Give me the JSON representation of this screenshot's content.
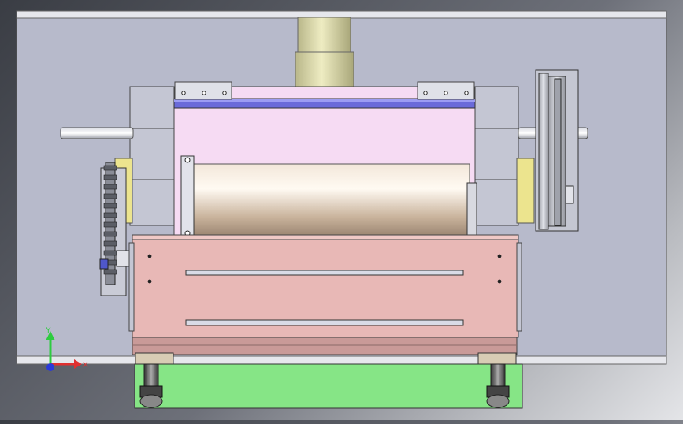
{
  "viewport": {
    "background_gradient": [
      "#3a3d44",
      "#6d7079",
      "#b9bbc0",
      "#e4e5e8"
    ]
  },
  "model": {
    "base_plate_color": "#b7bacb",
    "rail_color": "#e6e7ec",
    "pink_housing_color": "#f6dbf3",
    "roller_color_light": "#fbf3e8",
    "roller_color_dark": "#b39c85",
    "lower_box_color": "#e8b8b6",
    "foot_plate_color": "#86e586",
    "spindle_color": "#d8d6a6",
    "sprocket_block_color": "#ece48e",
    "blue_rail_color": "#6a6ad9"
  },
  "triad": {
    "y_label": "Y",
    "x_label": "X",
    "y_color": "#2ecc40",
    "x_color": "#e03030",
    "z_color": "#2a3ad8"
  }
}
